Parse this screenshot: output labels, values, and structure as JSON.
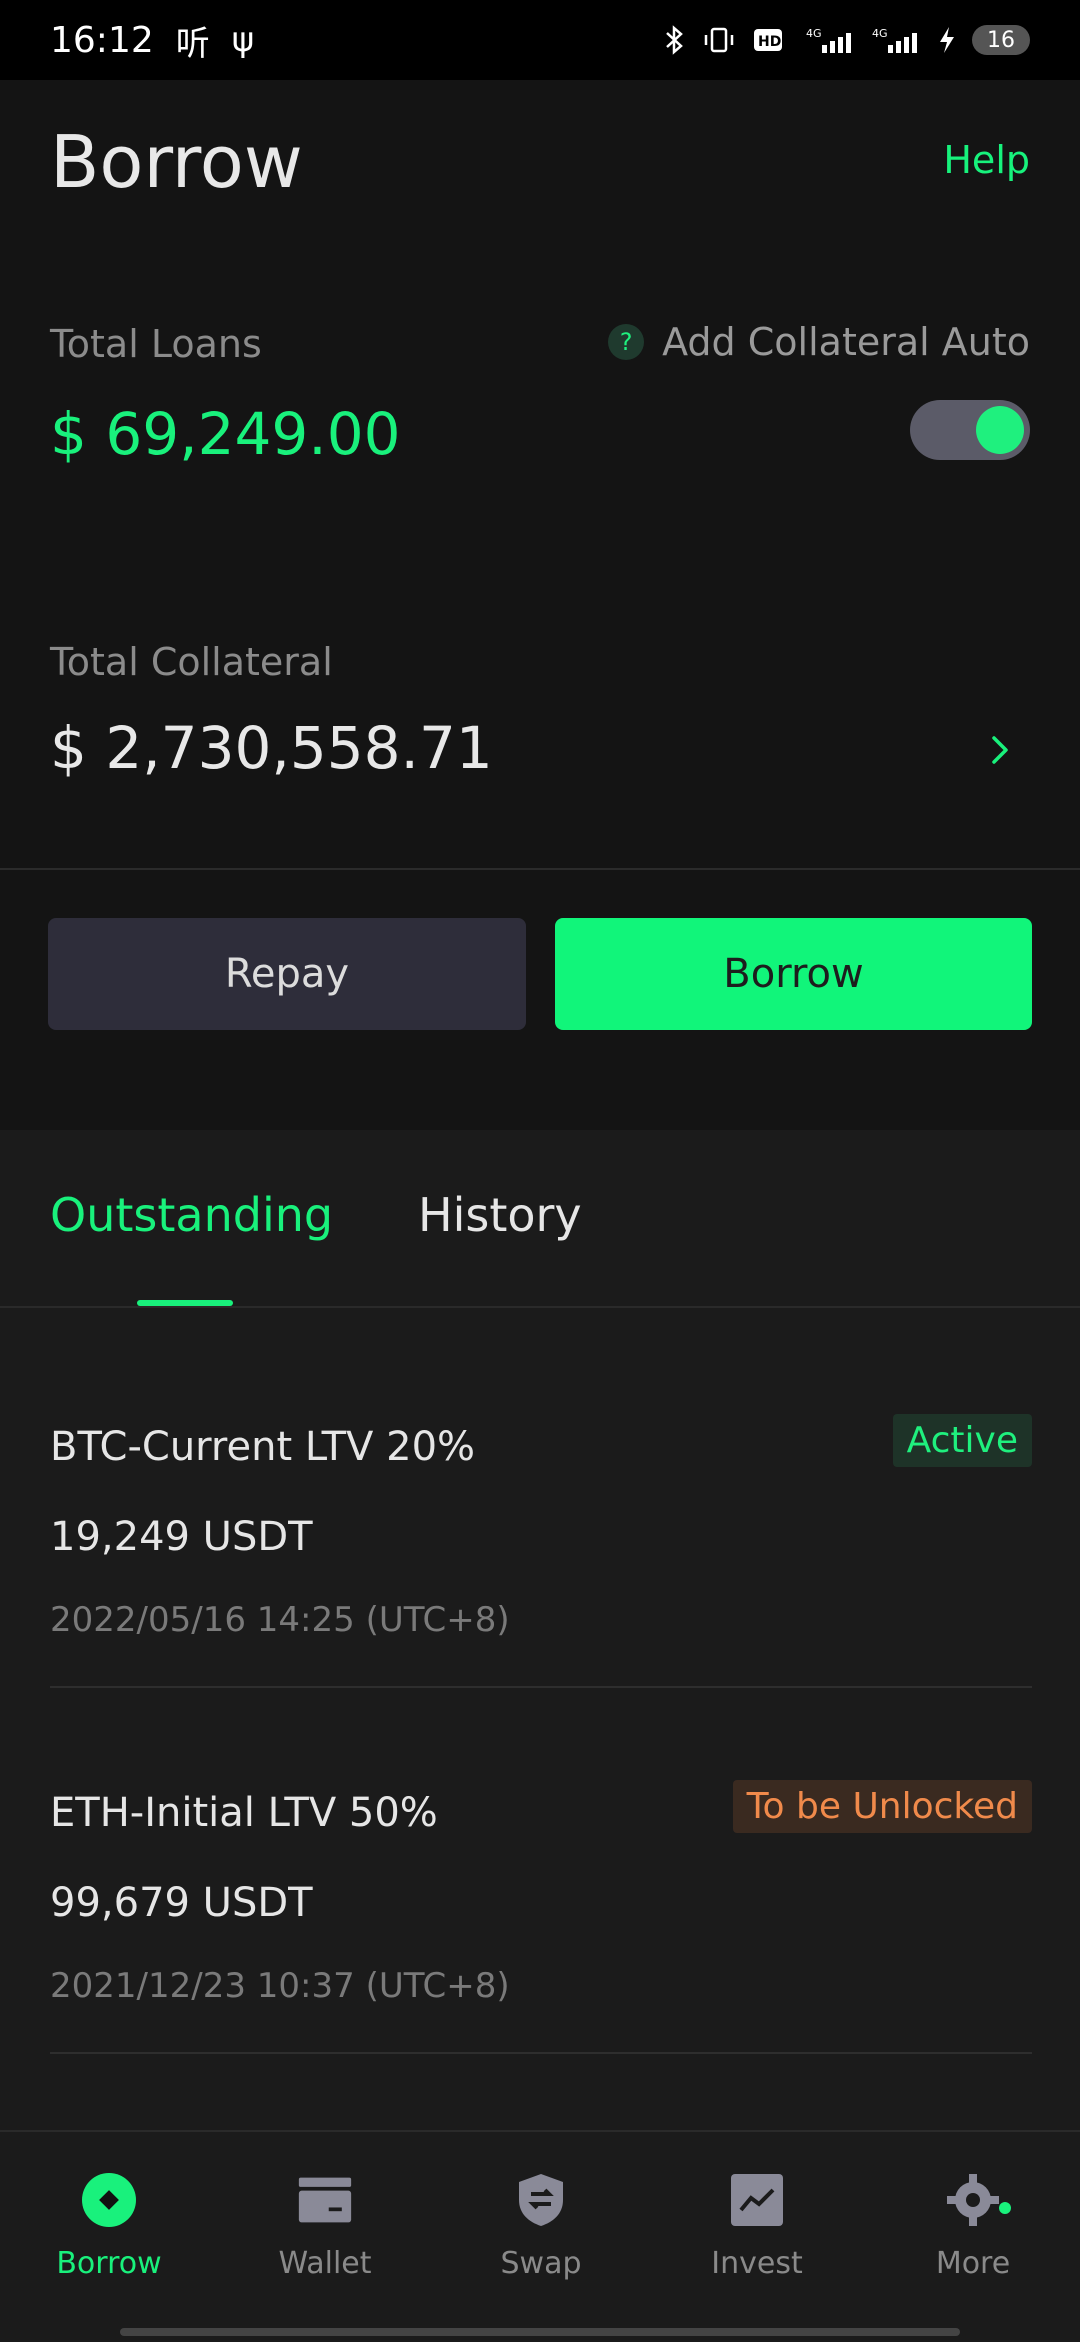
{
  "status_bar": {
    "time": "16:12",
    "left_icons": [
      "听",
      "ψ"
    ],
    "battery": "16"
  },
  "header": {
    "title": "Borrow",
    "help_label": "Help"
  },
  "summary": {
    "total_loans_label": "Total Loans",
    "total_loans_value": "$ 69,249.00",
    "auto_label": "Add Collateral Auto",
    "help_badge": "?",
    "auto_enabled": true,
    "total_collateral_label": "Total Collateral",
    "total_collateral_value": "$ 2,730,558.71"
  },
  "actions": {
    "repay_label": "Repay",
    "borrow_label": "Borrow"
  },
  "tabs": [
    {
      "label": "Outstanding",
      "active": true
    },
    {
      "label": "History",
      "active": false
    }
  ],
  "loans": [
    {
      "title": "BTC-Current LTV 20%",
      "amount": "19,249 USDT",
      "date": "2022/05/16 14:25 (UTC+8)",
      "status": "Active"
    },
    {
      "title": "ETH-Initial LTV 50%",
      "amount": "99,679 USDT",
      "date": "2021/12/23 10:37 (UTC+8)",
      "status": "To be Unlocked"
    }
  ],
  "bottom_nav": [
    {
      "label": "Borrow",
      "icon": "borrow-icon",
      "active": true
    },
    {
      "label": "Wallet",
      "icon": "wallet-icon",
      "active": false
    },
    {
      "label": "Swap",
      "icon": "swap-icon",
      "active": false
    },
    {
      "label": "Invest",
      "icon": "invest-icon",
      "active": false
    },
    {
      "label": "More",
      "icon": "gear-icon",
      "active": false
    }
  ],
  "colors": {
    "accent": "#19f17c",
    "background": "#141414",
    "panel": "#1b1b1b",
    "warning": "#f08a4b"
  }
}
